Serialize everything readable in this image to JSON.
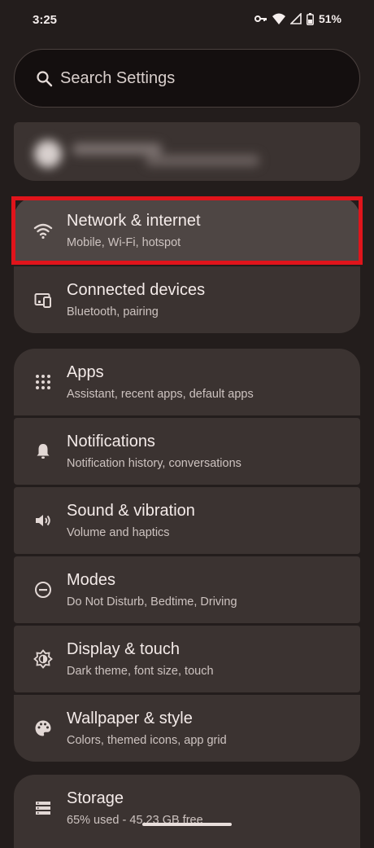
{
  "status_bar": {
    "time": "3:25",
    "battery": "51%"
  },
  "search": {
    "placeholder": "Search Settings"
  },
  "groups": [
    {
      "items": [
        {
          "title": "Network & internet",
          "subtitle": "Mobile, Wi-Fi, hotspot",
          "icon": "wifi-icon",
          "highlighted": true
        },
        {
          "title": "Connected devices",
          "subtitle": "Bluetooth, pairing",
          "icon": "devices-icon"
        }
      ]
    },
    {
      "items": [
        {
          "title": "Apps",
          "subtitle": "Assistant, recent apps, default apps",
          "icon": "apps-grid-icon"
        },
        {
          "title": "Notifications",
          "subtitle": "Notification history, conversations",
          "icon": "bell-icon"
        },
        {
          "title": "Sound & vibration",
          "subtitle": "Volume and haptics",
          "icon": "volume-icon"
        },
        {
          "title": "Modes",
          "subtitle": "Do Not Disturb, Bedtime, Driving",
          "icon": "modes-icon"
        },
        {
          "title": "Display & touch",
          "subtitle": "Dark theme, font size, touch",
          "icon": "brightness-icon"
        },
        {
          "title": "Wallpaper & style",
          "subtitle": "Colors, themed icons, app grid",
          "icon": "palette-icon"
        }
      ]
    },
    {
      "items": [
        {
          "title": "Storage",
          "subtitle": "65% used - 45.23 GB free",
          "icon": "storage-icon"
        }
      ]
    }
  ],
  "colors": {
    "background": "#231d1c",
    "card": "#3b3331",
    "highlight_border": "#e0141b"
  }
}
